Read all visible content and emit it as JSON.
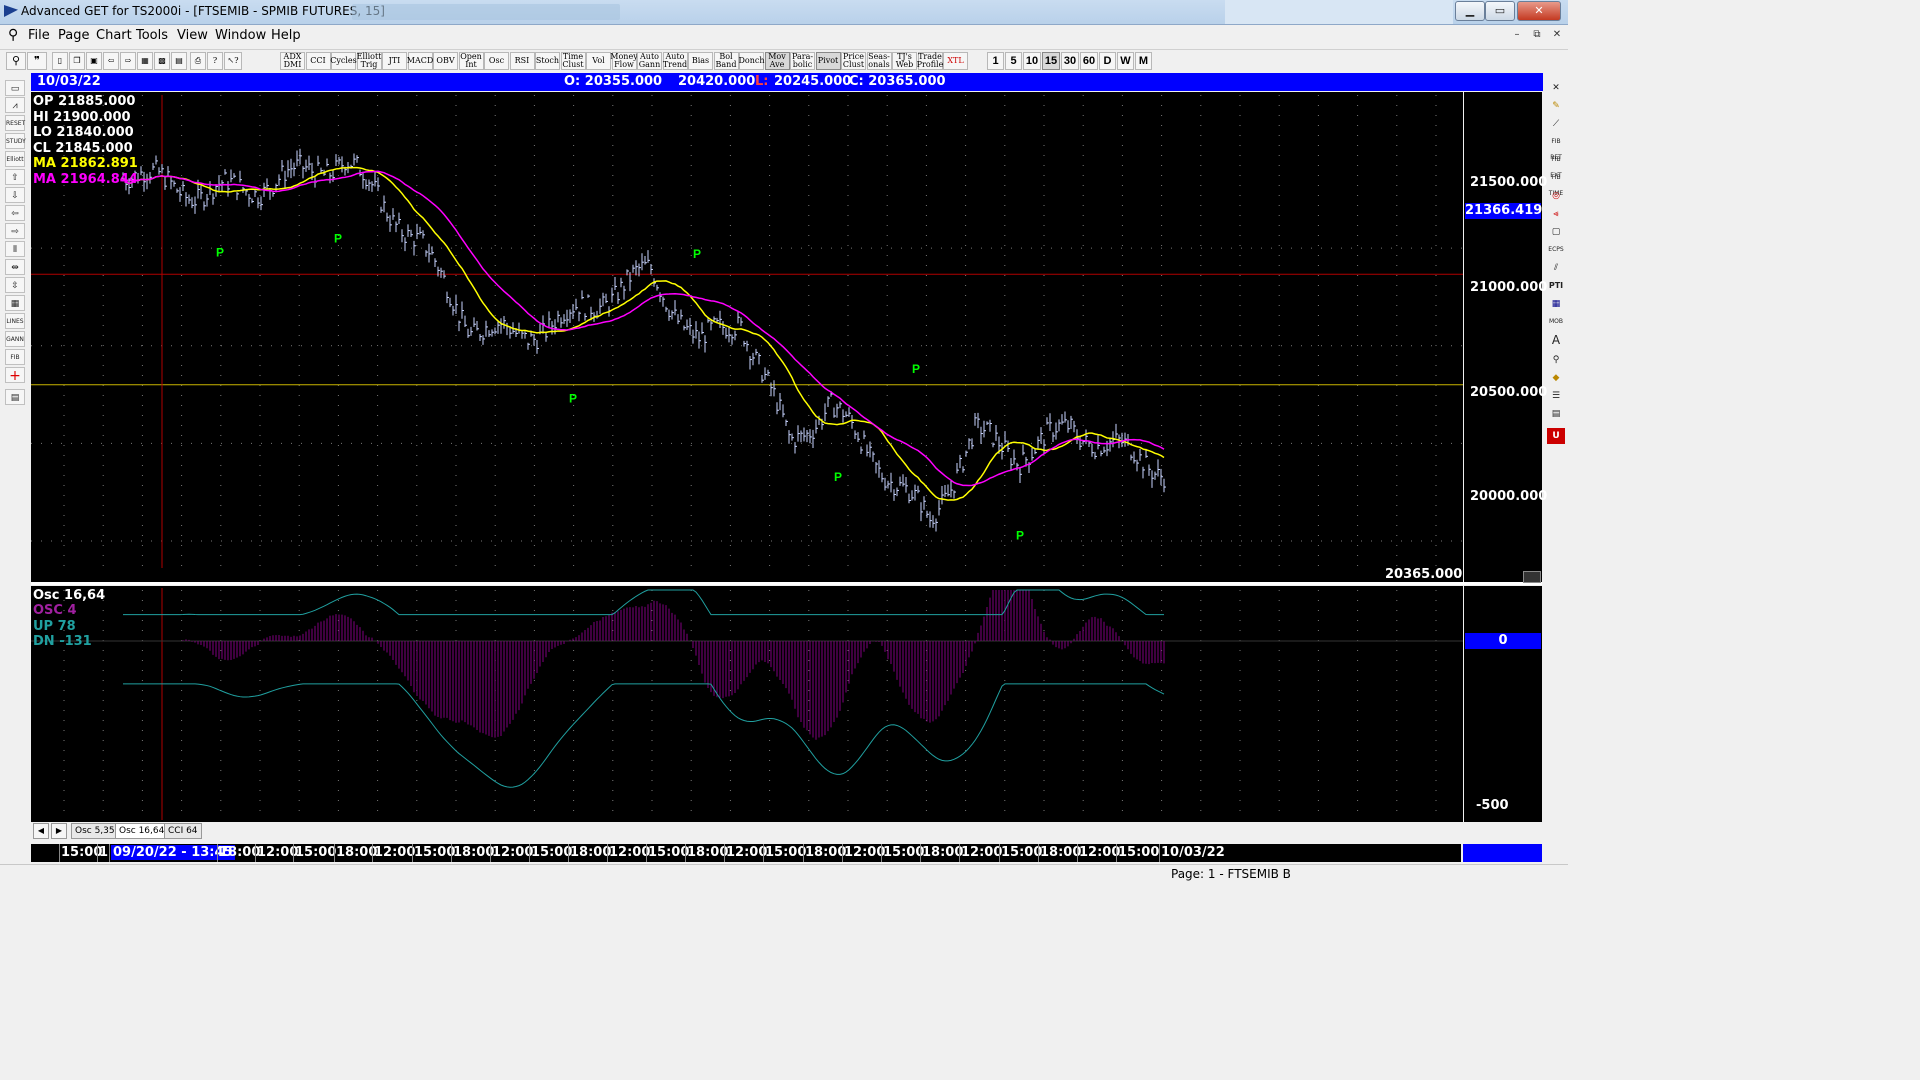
{
  "window": {
    "title": "Advanced GET for TS2000i - [FTSEMIB - SPMIB FUTURES, 15]"
  },
  "menu": [
    {
      "label": "File",
      "key": "F"
    },
    {
      "label": "Page",
      "key": "P"
    },
    {
      "label": "Chart",
      "key": "C"
    },
    {
      "label": "Tools",
      "key": "T"
    },
    {
      "label": "View",
      "key": "V"
    },
    {
      "label": "Window",
      "key": "W"
    },
    {
      "label": "Help",
      "key": "H"
    }
  ],
  "toolbar_studies": [
    "ADX DMI",
    "CCI",
    "Cycles",
    "Elliott Trig",
    "JTI",
    "MACD",
    "OBV",
    "Open Int",
    "Osc",
    "RSI",
    "Stoch",
    "Time Clust",
    "Vol",
    "Money Flow",
    "Auto Gann",
    "Auto Trend",
    "Bias",
    "Bol Band",
    "Donch",
    "Mov Ave",
    "Para-bolic",
    "Pivot",
    "Price Clust",
    "Seas-onals",
    "TJ's Web",
    "Trade Profile",
    "XTL"
  ],
  "toolbar_intervals": [
    "1",
    "5",
    "10",
    "15",
    "30",
    "60",
    "D",
    "W",
    "M"
  ],
  "toolbar_interval_selected": "15",
  "infobar": {
    "date": "10/03/22",
    "open": "O: 20355.000",
    "high": "20420.000",
    "low_label": "L:",
    "low": "20245.000",
    "close": "C: 20365.000"
  },
  "price_legend": [
    {
      "label": "OP",
      "value": "21885.000",
      "color": "#ffffff"
    },
    {
      "label": "HI",
      "value": "21900.000",
      "color": "#ffffff"
    },
    {
      "label": "LO",
      "value": "21840.000",
      "color": "#ffffff"
    },
    {
      "label": "CL",
      "value": "21845.000",
      "color": "#ffffff"
    },
    {
      "label": "MA",
      "value": "21862.891",
      "color": "#ffff00"
    },
    {
      "label": "MA",
      "value": "21964.844",
      "color": "#ff00ff"
    }
  ],
  "price_axis": {
    "ticks": [
      "21500.000",
      "21000.000",
      "20500.000",
      "20000.000"
    ],
    "cursor_tag": "21366.419",
    "last_value": "20365.000"
  },
  "osc_legend": {
    "title": "Osc 16,64",
    "osc": "OSC 4",
    "up": "UP   78",
    "dn": "DN   -131"
  },
  "osc_axis": {
    "zero_tag": "0",
    "bottom_tick": "-500"
  },
  "tabs": [
    "Osc 5,35",
    "Osc 16,64",
    "CCI 64"
  ],
  "active_tab": "Osc 16,64",
  "time_axis": {
    "labels": [
      "15:00",
      "1",
      "09/20/22 - 13:45",
      "18:00",
      "12:00",
      "15:00",
      "18:00",
      "12:00",
      "15:00",
      "18:00",
      "12:00",
      "15:00",
      "18:00",
      "12:00",
      "15:00",
      "18:00",
      "12:00",
      "15:00",
      "18:00",
      "12:00",
      "15:00",
      "18:00",
      "12:00",
      "15:00",
      "18:00",
      "12:00",
      "15:00",
      "10/03/22"
    ]
  },
  "status": {
    "page": "Page: 1 - FTSEMIB B"
  },
  "colors": {
    "background": "#000000",
    "candles": "#c8d4ff",
    "ma_fast": "#ffff00",
    "ma_slow": "#ff00ff",
    "pivot_marker": "#00ff00",
    "osc_histogram": "#800080",
    "osc_bands": "#20a0a0",
    "info_bar": "#0000ff"
  },
  "chart_data": {
    "type": "line",
    "title": "FTSEMIB - SPMIB FUTURES, 15",
    "symbol": "FTSEMIB",
    "interval": "15",
    "ylim": [
      19800,
      22300
    ],
    "horizontal_lines": [
      21366.419,
      20800
    ],
    "close_approx": [
      {
        "t": "09/16",
        "v": 21900
      },
      {
        "t": "09/19",
        "v": 21780
      },
      {
        "t": "09/20",
        "v": 21820
      },
      {
        "t": "09/21",
        "v": 21950
      },
      {
        "t": "09/22",
        "v": 21520
      },
      {
        "t": "09/22b",
        "v": 21100
      },
      {
        "t": "09/23",
        "v": 21050
      },
      {
        "t": "09/26",
        "v": 21150
      },
      {
        "t": "09/27",
        "v": 21380
      },
      {
        "t": "09/28",
        "v": 21000
      },
      {
        "t": "09/29",
        "v": 21150
      },
      {
        "t": "09/29b",
        "v": 20500
      },
      {
        "t": "09/30",
        "v": 20700
      },
      {
        "t": "09/30b",
        "v": 20450
      },
      {
        "t": "10/03",
        "v": 20100
      },
      {
        "t": "10/03b",
        "v": 20550
      },
      {
        "t": "10/03c",
        "v": 20440
      },
      {
        "t": "10/03d",
        "v": 20580
      },
      {
        "t": "10/03e",
        "v": 20365
      }
    ],
    "series": [
      {
        "name": "MA",
        "last": 21862.891
      },
      {
        "name": "MA",
        "last": 21964.844
      }
    ],
    "pivots": [
      {
        "label": "P",
        "type": "low",
        "v": 21530
      },
      {
        "label": "P",
        "type": "low",
        "v": 21600
      },
      {
        "label": "P",
        "type": "high",
        "v": 21420
      },
      {
        "label": "P",
        "type": "low",
        "v": 20780
      },
      {
        "label": "P",
        "type": "high",
        "v": 20830
      },
      {
        "label": "P",
        "type": "low",
        "v": 20380
      },
      {
        "label": "P",
        "type": "low",
        "v": 20080
      }
    ]
  }
}
